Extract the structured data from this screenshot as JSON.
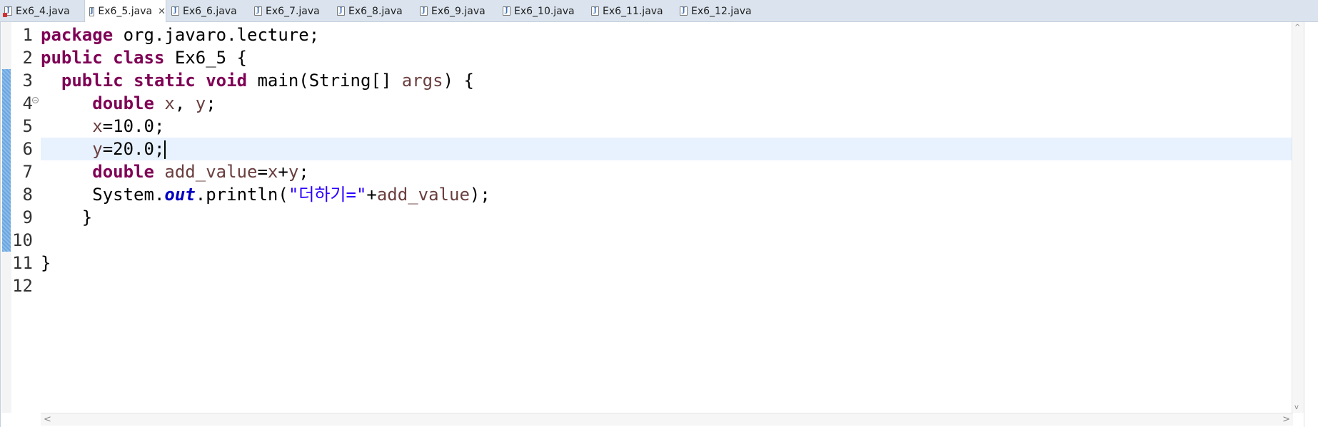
{
  "tabs": [
    {
      "label": "Ex6_4.java",
      "icon": "java-file-error-icon",
      "active": false
    },
    {
      "label": "Ex6_5.java",
      "icon": "java-file-icon",
      "active": true,
      "close": "✕"
    },
    {
      "label": "Ex6_6.java",
      "icon": "java-file-icon",
      "active": false
    },
    {
      "label": "Ex6_7.java",
      "icon": "java-file-icon",
      "active": false
    },
    {
      "label": "Ex6_8.java",
      "icon": "java-file-icon",
      "active": false
    },
    {
      "label": "Ex6_9.java",
      "icon": "java-file-icon",
      "active": false
    },
    {
      "label": "Ex6_10.java",
      "icon": "java-file-icon",
      "active": false
    },
    {
      "label": "Ex6_11.java",
      "icon": "java-file-icon",
      "active": false
    },
    {
      "label": "Ex6_12.java",
      "icon": "java-file-icon",
      "active": false
    }
  ],
  "editor": {
    "line_numbers": [
      "1",
      "2",
      "3",
      "4",
      "5",
      "6",
      "7",
      "8",
      "9",
      "10",
      "11",
      "12"
    ],
    "current_line": 6,
    "code": {
      "l1_kw": "package",
      "l1_rest": " org.javaro.lecture;",
      "l2_kw1": "public",
      "l2_kw2": "class",
      "l2_rest": " Ex6_5 {",
      "l3_kw1": "public",
      "l3_kw2": "static",
      "l3_kw3": "void",
      "l3_rest1": " main(String[] ",
      "l3_var": "args",
      "l3_rest2": ") {",
      "l4_kw": "double",
      "l4_v1": "x",
      "l4_sep": ", ",
      "l4_v2": "y",
      "l4_end": ";",
      "l5_var": "x",
      "l5_rest": "=10.0;",
      "l6_var": "y",
      "l6_rest": "=20.0;",
      "l7_kw": "double",
      "l7_var": "add_value",
      "l7_eq": "=",
      "l7_x": "x",
      "l7_plus": "+",
      "l7_y": "y",
      "l7_end": ";",
      "l8_a": "System.",
      "l8_field": "out",
      "l8_b": ".println(",
      "l8_str": "\"더하기=\"",
      "l8_c": "+",
      "l8_var": "add_value",
      "l8_d": ");",
      "l9": "}",
      "l11": "}"
    }
  },
  "scroll": {
    "left": "<",
    "right": ">",
    "up": "^",
    "down": "v"
  }
}
